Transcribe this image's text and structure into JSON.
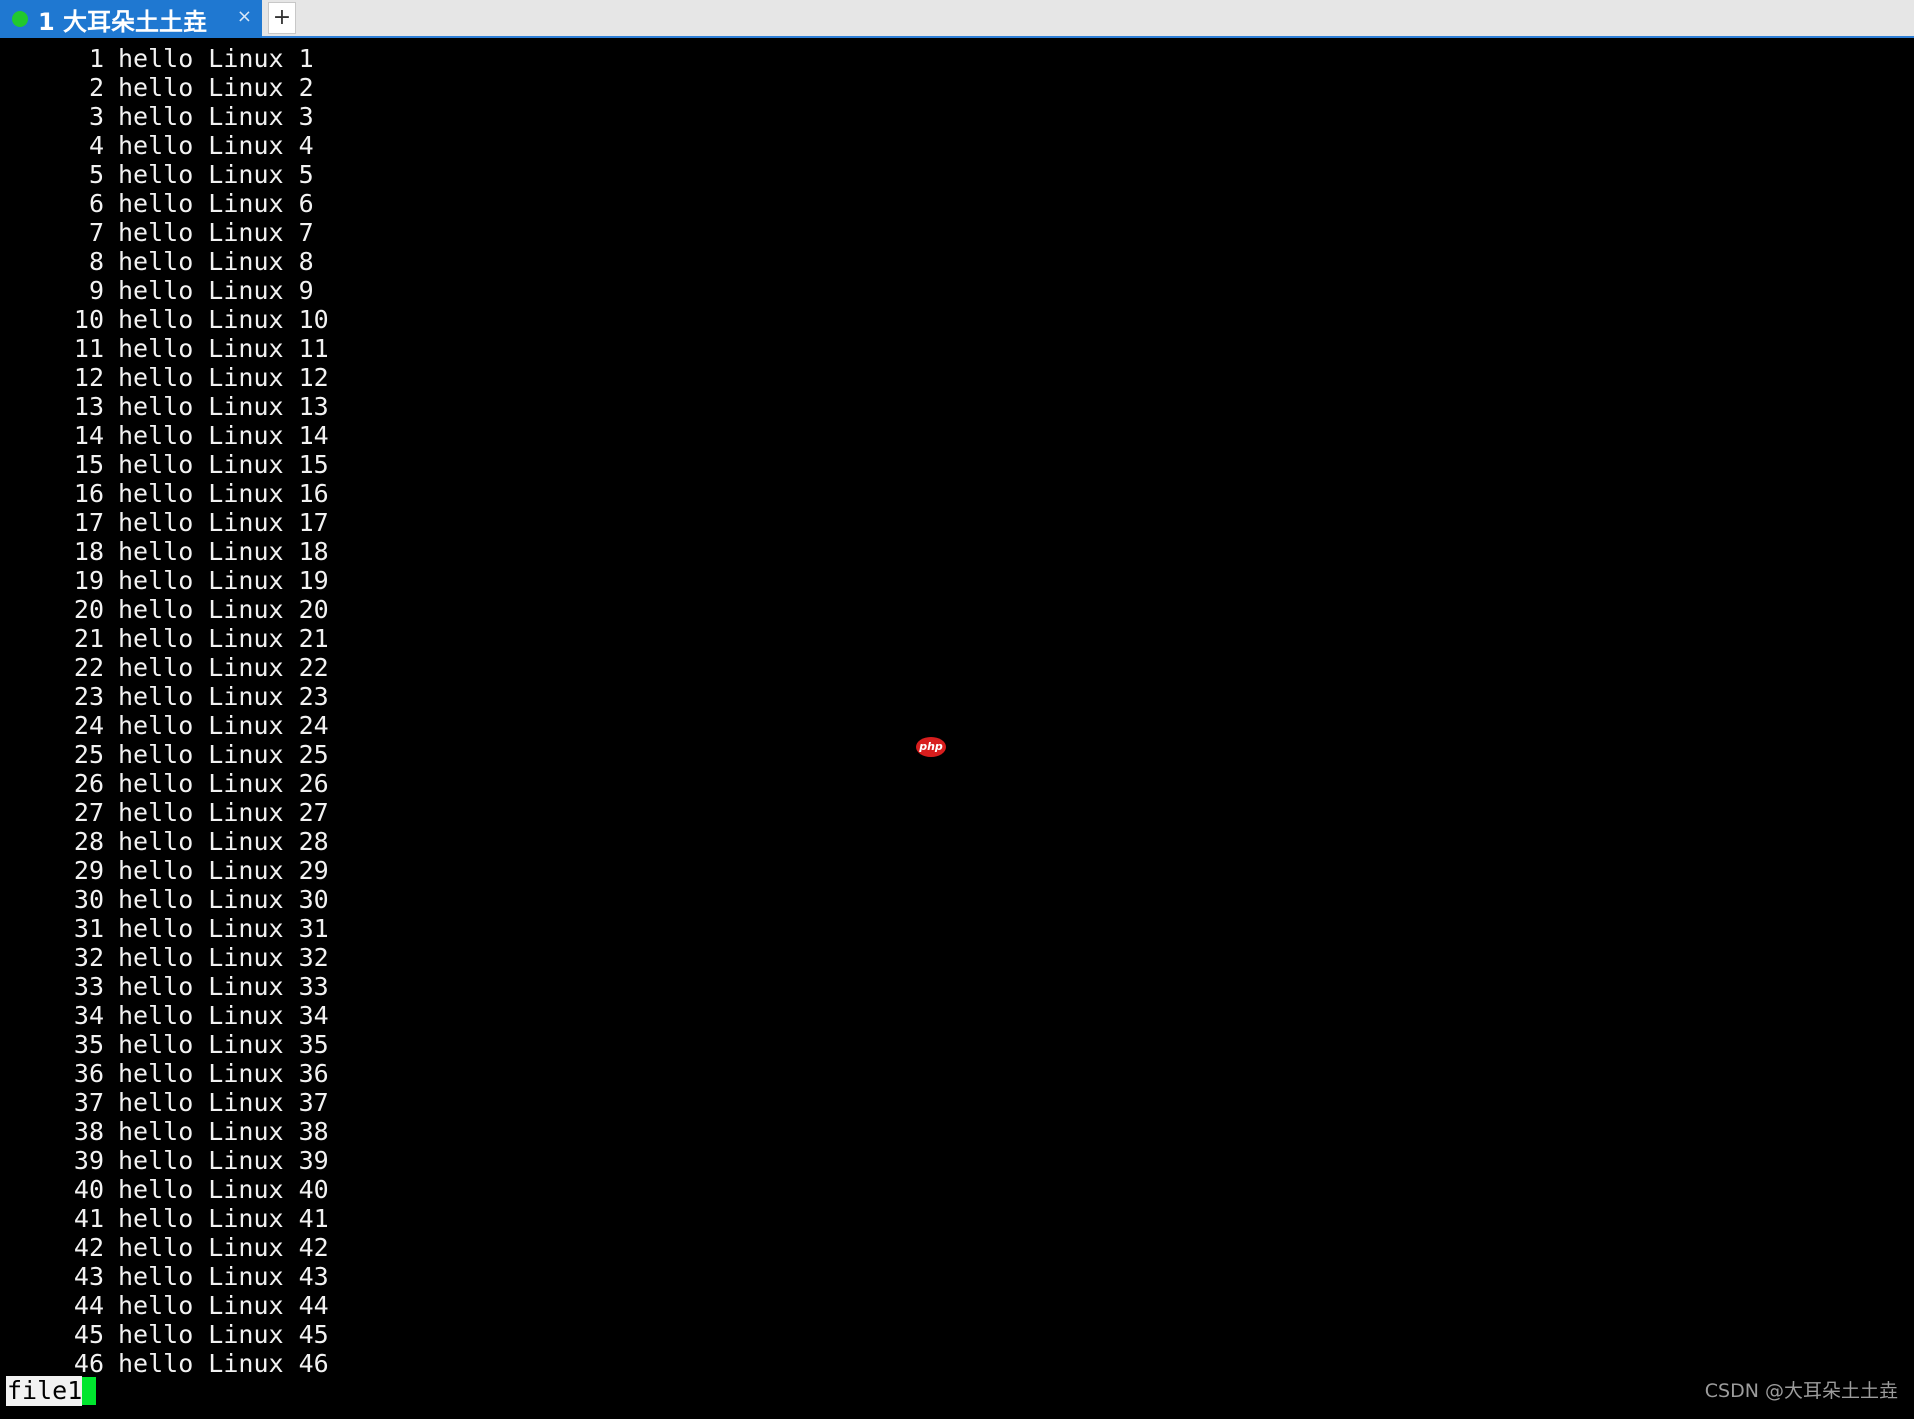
{
  "tab": {
    "label": "1 大耳朵土土垚",
    "close_glyph": "×",
    "status_color": "#21c92e"
  },
  "new_tab_glyph": "+",
  "terminal": {
    "lines": [
      {
        "num": "1",
        "text": "hello Linux 1"
      },
      {
        "num": "2",
        "text": "hello Linux 2"
      },
      {
        "num": "3",
        "text": "hello Linux 3"
      },
      {
        "num": "4",
        "text": "hello Linux 4"
      },
      {
        "num": "5",
        "text": "hello Linux 5"
      },
      {
        "num": "6",
        "text": "hello Linux 6"
      },
      {
        "num": "7",
        "text": "hello Linux 7"
      },
      {
        "num": "8",
        "text": "hello Linux 8"
      },
      {
        "num": "9",
        "text": "hello Linux 9"
      },
      {
        "num": "10",
        "text": "hello Linux 10"
      },
      {
        "num": "11",
        "text": "hello Linux 11"
      },
      {
        "num": "12",
        "text": "hello Linux 12"
      },
      {
        "num": "13",
        "text": "hello Linux 13"
      },
      {
        "num": "14",
        "text": "hello Linux 14"
      },
      {
        "num": "15",
        "text": "hello Linux 15"
      },
      {
        "num": "16",
        "text": "hello Linux 16"
      },
      {
        "num": "17",
        "text": "hello Linux 17"
      },
      {
        "num": "18",
        "text": "hello Linux 18"
      },
      {
        "num": "19",
        "text": "hello Linux 19"
      },
      {
        "num": "20",
        "text": "hello Linux 20"
      },
      {
        "num": "21",
        "text": "hello Linux 21"
      },
      {
        "num": "22",
        "text": "hello Linux 22"
      },
      {
        "num": "23",
        "text": "hello Linux 23"
      },
      {
        "num": "24",
        "text": "hello Linux 24"
      },
      {
        "num": "25",
        "text": "hello Linux 25"
      },
      {
        "num": "26",
        "text": "hello Linux 26"
      },
      {
        "num": "27",
        "text": "hello Linux 27"
      },
      {
        "num": "28",
        "text": "hello Linux 28"
      },
      {
        "num": "29",
        "text": "hello Linux 29"
      },
      {
        "num": "30",
        "text": "hello Linux 30"
      },
      {
        "num": "31",
        "text": "hello Linux 31"
      },
      {
        "num": "32",
        "text": "hello Linux 32"
      },
      {
        "num": "33",
        "text": "hello Linux 33"
      },
      {
        "num": "34",
        "text": "hello Linux 34"
      },
      {
        "num": "35",
        "text": "hello Linux 35"
      },
      {
        "num": "36",
        "text": "hello Linux 36"
      },
      {
        "num": "37",
        "text": "hello Linux 37"
      },
      {
        "num": "38",
        "text": "hello Linux 38"
      },
      {
        "num": "39",
        "text": "hello Linux 39"
      },
      {
        "num": "40",
        "text": "hello Linux 40"
      },
      {
        "num": "41",
        "text": "hello Linux 41"
      },
      {
        "num": "42",
        "text": "hello Linux 42"
      },
      {
        "num": "43",
        "text": "hello Linux 43"
      },
      {
        "num": "44",
        "text": "hello Linux 44"
      },
      {
        "num": "45",
        "text": "hello Linux 45"
      },
      {
        "num": "46",
        "text": "hello Linux 46"
      }
    ],
    "status_filename": "file1",
    "cursor_color": "#00e62e"
  },
  "overlay_logo_text": "php",
  "watermark": "CSDN @大耳朵土土垚"
}
